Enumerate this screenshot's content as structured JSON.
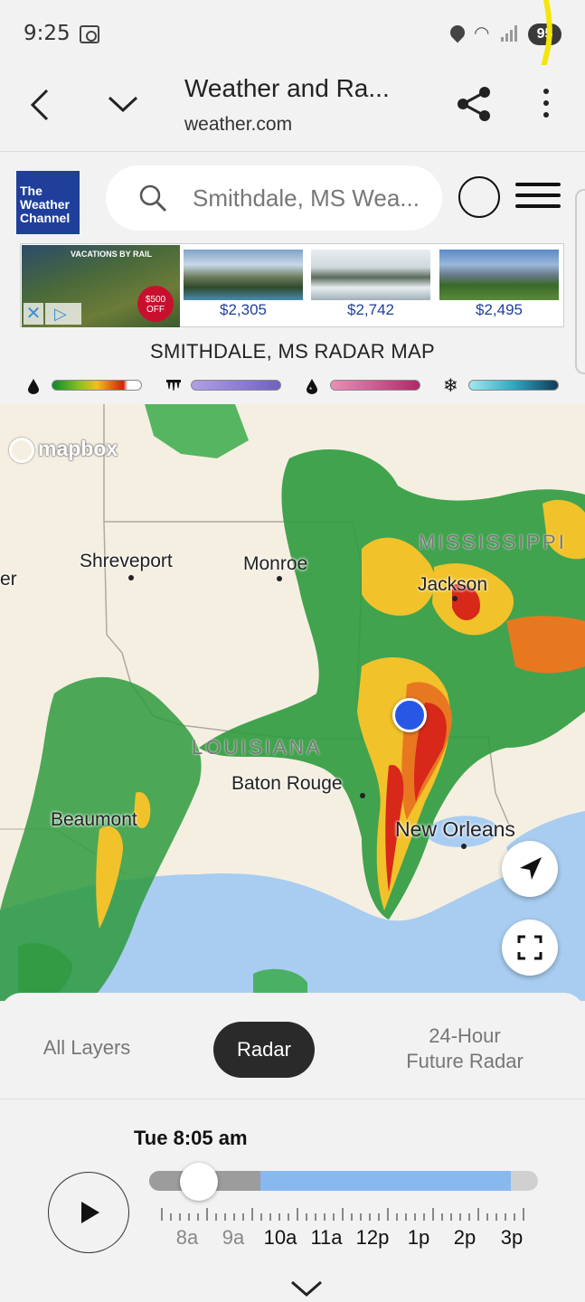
{
  "status_bar": {
    "time": "9:25",
    "battery": "95"
  },
  "browser": {
    "title": "Weather and Ra...",
    "url": "weather.com"
  },
  "site": {
    "logo_lines": [
      "The",
      "Weather",
      "Channel"
    ],
    "search_placeholder": "Smithdale, MS Wea..."
  },
  "ad": {
    "brand": "VACATIONS BY RAIL",
    "badge": "$500 OFF",
    "tiles": [
      {
        "price": "$2,305"
      },
      {
        "price": "$2,742"
      },
      {
        "price": "$2,495"
      }
    ]
  },
  "map_title": "SMITHDALE, MS RADAR MAP",
  "legend": [
    {
      "icon": "rain-icon",
      "colors": [
        "#0a8a2a",
        "#f0d020",
        "#d02010",
        "#ffffff"
      ]
    },
    {
      "icon": "ice-icon",
      "colors": [
        "#9a8ad8",
        "#7a6ac8"
      ]
    },
    {
      "icon": "mix-icon",
      "colors": [
        "#e070a0",
        "#b03070"
      ]
    },
    {
      "icon": "snow-icon",
      "colors": [
        "#80d8e8",
        "#103a58"
      ]
    }
  ],
  "map": {
    "attribution": "mapbox",
    "cities": {
      "shreveport": "Shreveport",
      "monroe": "Monroe",
      "jackson": "Jackson",
      "baton_rouge": "Baton Rouge",
      "beaumont": "Beaumont",
      "new_orleans": "New Orleans",
      "edge": "er"
    },
    "states": {
      "mississippi": "MISSISSIPPI",
      "louisiana": "LOUISIANA"
    }
  },
  "panel": {
    "tabs": {
      "all_layers": "All Layers",
      "radar": "Radar",
      "future_line1": "24-Hour",
      "future_line2": "Future Radar"
    },
    "current_time": "Tue 8:05 am",
    "hours": [
      "8a",
      "9a",
      "10a",
      "11a",
      "12p",
      "1p",
      "2p",
      "3p"
    ],
    "progress_fraction": 0.05
  },
  "colors": {
    "accent_blue": "#2857e6",
    "logo_blue": "#1f3f9b",
    "future_track": "#88b8f0"
  }
}
